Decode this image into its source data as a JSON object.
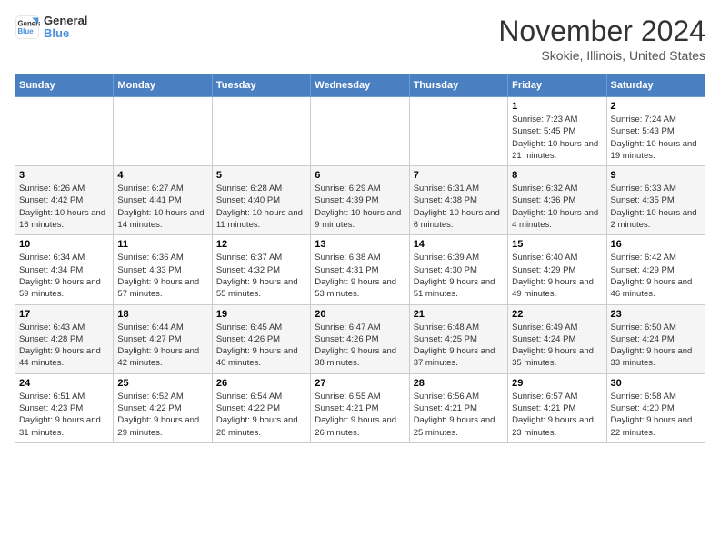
{
  "logo": {
    "line1": "General",
    "line2": "Blue"
  },
  "header": {
    "month": "November 2024",
    "location": "Skokie, Illinois, United States"
  },
  "weekdays": [
    "Sunday",
    "Monday",
    "Tuesday",
    "Wednesday",
    "Thursday",
    "Friday",
    "Saturday"
  ],
  "weeks": [
    [
      {
        "day": "",
        "info": ""
      },
      {
        "day": "",
        "info": ""
      },
      {
        "day": "",
        "info": ""
      },
      {
        "day": "",
        "info": ""
      },
      {
        "day": "",
        "info": ""
      },
      {
        "day": "1",
        "info": "Sunrise: 7:23 AM\nSunset: 5:45 PM\nDaylight: 10 hours and 21 minutes."
      },
      {
        "day": "2",
        "info": "Sunrise: 7:24 AM\nSunset: 5:43 PM\nDaylight: 10 hours and 19 minutes."
      }
    ],
    [
      {
        "day": "3",
        "info": "Sunrise: 6:26 AM\nSunset: 4:42 PM\nDaylight: 10 hours and 16 minutes."
      },
      {
        "day": "4",
        "info": "Sunrise: 6:27 AM\nSunset: 4:41 PM\nDaylight: 10 hours and 14 minutes."
      },
      {
        "day": "5",
        "info": "Sunrise: 6:28 AM\nSunset: 4:40 PM\nDaylight: 10 hours and 11 minutes."
      },
      {
        "day": "6",
        "info": "Sunrise: 6:29 AM\nSunset: 4:39 PM\nDaylight: 10 hours and 9 minutes."
      },
      {
        "day": "7",
        "info": "Sunrise: 6:31 AM\nSunset: 4:38 PM\nDaylight: 10 hours and 6 minutes."
      },
      {
        "day": "8",
        "info": "Sunrise: 6:32 AM\nSunset: 4:36 PM\nDaylight: 10 hours and 4 minutes."
      },
      {
        "day": "9",
        "info": "Sunrise: 6:33 AM\nSunset: 4:35 PM\nDaylight: 10 hours and 2 minutes."
      }
    ],
    [
      {
        "day": "10",
        "info": "Sunrise: 6:34 AM\nSunset: 4:34 PM\nDaylight: 9 hours and 59 minutes."
      },
      {
        "day": "11",
        "info": "Sunrise: 6:36 AM\nSunset: 4:33 PM\nDaylight: 9 hours and 57 minutes."
      },
      {
        "day": "12",
        "info": "Sunrise: 6:37 AM\nSunset: 4:32 PM\nDaylight: 9 hours and 55 minutes."
      },
      {
        "day": "13",
        "info": "Sunrise: 6:38 AM\nSunset: 4:31 PM\nDaylight: 9 hours and 53 minutes."
      },
      {
        "day": "14",
        "info": "Sunrise: 6:39 AM\nSunset: 4:30 PM\nDaylight: 9 hours and 51 minutes."
      },
      {
        "day": "15",
        "info": "Sunrise: 6:40 AM\nSunset: 4:29 PM\nDaylight: 9 hours and 49 minutes."
      },
      {
        "day": "16",
        "info": "Sunrise: 6:42 AM\nSunset: 4:29 PM\nDaylight: 9 hours and 46 minutes."
      }
    ],
    [
      {
        "day": "17",
        "info": "Sunrise: 6:43 AM\nSunset: 4:28 PM\nDaylight: 9 hours and 44 minutes."
      },
      {
        "day": "18",
        "info": "Sunrise: 6:44 AM\nSunset: 4:27 PM\nDaylight: 9 hours and 42 minutes."
      },
      {
        "day": "19",
        "info": "Sunrise: 6:45 AM\nSunset: 4:26 PM\nDaylight: 9 hours and 40 minutes."
      },
      {
        "day": "20",
        "info": "Sunrise: 6:47 AM\nSunset: 4:26 PM\nDaylight: 9 hours and 38 minutes."
      },
      {
        "day": "21",
        "info": "Sunrise: 6:48 AM\nSunset: 4:25 PM\nDaylight: 9 hours and 37 minutes."
      },
      {
        "day": "22",
        "info": "Sunrise: 6:49 AM\nSunset: 4:24 PM\nDaylight: 9 hours and 35 minutes."
      },
      {
        "day": "23",
        "info": "Sunrise: 6:50 AM\nSunset: 4:24 PM\nDaylight: 9 hours and 33 minutes."
      }
    ],
    [
      {
        "day": "24",
        "info": "Sunrise: 6:51 AM\nSunset: 4:23 PM\nDaylight: 9 hours and 31 minutes."
      },
      {
        "day": "25",
        "info": "Sunrise: 6:52 AM\nSunset: 4:22 PM\nDaylight: 9 hours and 29 minutes."
      },
      {
        "day": "26",
        "info": "Sunrise: 6:54 AM\nSunset: 4:22 PM\nDaylight: 9 hours and 28 minutes."
      },
      {
        "day": "27",
        "info": "Sunrise: 6:55 AM\nSunset: 4:21 PM\nDaylight: 9 hours and 26 minutes."
      },
      {
        "day": "28",
        "info": "Sunrise: 6:56 AM\nSunset: 4:21 PM\nDaylight: 9 hours and 25 minutes."
      },
      {
        "day": "29",
        "info": "Sunrise: 6:57 AM\nSunset: 4:21 PM\nDaylight: 9 hours and 23 minutes."
      },
      {
        "day": "30",
        "info": "Sunrise: 6:58 AM\nSunset: 4:20 PM\nDaylight: 9 hours and 22 minutes."
      }
    ]
  ]
}
